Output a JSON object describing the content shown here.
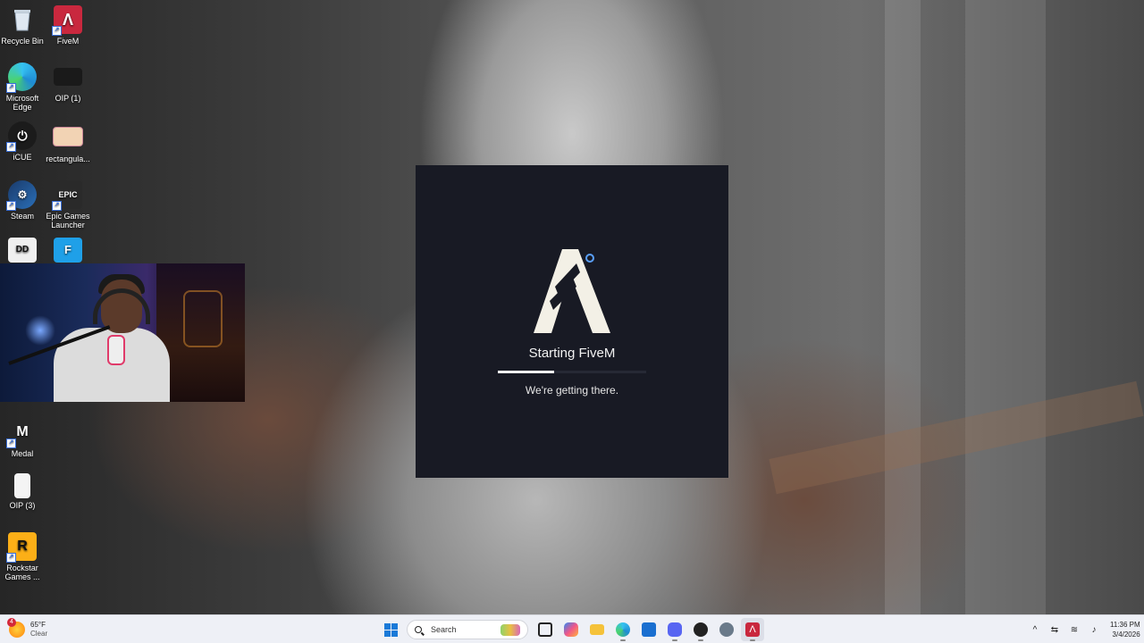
{
  "desktop": {
    "icons": [
      {
        "label": "Recycle Bin"
      },
      {
        "label": "FiveM"
      },
      {
        "label": "Microsoft Edge"
      },
      {
        "label": "OIP (1)"
      },
      {
        "label": "iCUE"
      },
      {
        "label": "rectangula..."
      },
      {
        "label": "Steam"
      },
      {
        "label": "Epic Games Launcher"
      },
      {
        "label": "Medal"
      },
      {
        "label": "OIP (3)"
      },
      {
        "label": "Rockstar Games ..."
      }
    ]
  },
  "splash": {
    "title": "Starting FiveM",
    "subtitle": "We're getting there.",
    "progress": 0.38,
    "logo_text": "Λ"
  },
  "taskbar": {
    "weather": {
      "temp": "65°F",
      "condition": "Clear",
      "badge": "4"
    },
    "search_placeholder": "Search",
    "clock": {
      "time": "11:36 PM",
      "date": "3/4/2026"
    }
  },
  "colors": {
    "splash_bg": "#181a24",
    "taskbar_bg": "#eef0f6",
    "fivem_brand": "#e8324a",
    "accent": "#1a7ad8"
  }
}
